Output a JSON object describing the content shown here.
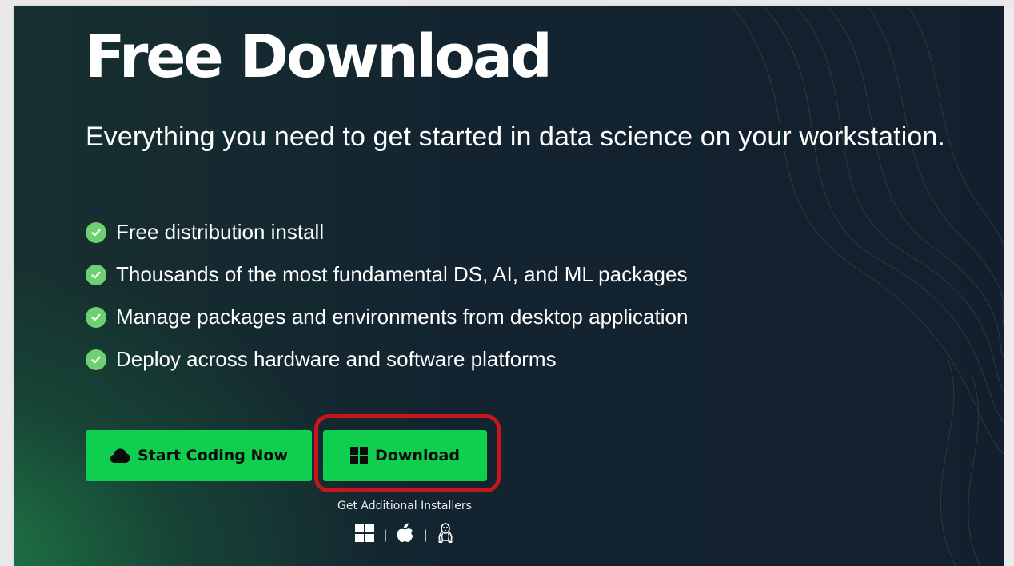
{
  "hero": {
    "title": "Free Download",
    "subtitle": "Everything you need to get started in data science on your workstation."
  },
  "features": [
    {
      "label": "Free distribution install",
      "icon": "check-circle-icon"
    },
    {
      "label": "Thousands of the most fundamental DS, AI, and ML packages",
      "icon": "check-circle-icon"
    },
    {
      "label": "Manage packages and environments from desktop application",
      "icon": "check-circle-icon"
    },
    {
      "label": "Deploy across hardware and software platforms",
      "icon": "check-circle-icon"
    }
  ],
  "buttons": {
    "start_coding": {
      "label": "Start Coding Now",
      "icon": "cloud-icon"
    },
    "download": {
      "label": "Download",
      "icon": "windows-icon"
    }
  },
  "installers": {
    "label": "Get Additional Installers",
    "separator": "|",
    "icons": [
      "windows-icon",
      "apple-icon",
      "linux-icon"
    ]
  },
  "colors": {
    "accent_green": "#11cf4e",
    "check_green": "#6fcf73",
    "highlight_red": "#c8151b",
    "background_dark": "#131f2d"
  }
}
